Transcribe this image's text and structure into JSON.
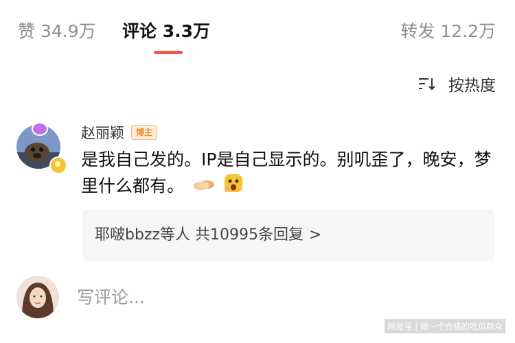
{
  "tabs": {
    "likes": "赞 34.9万",
    "comments": "评论 3.3万",
    "reposts": "转发 12.2万"
  },
  "sort": {
    "label": "按热度",
    "icon": "sort-icon"
  },
  "comment": {
    "user_name": "赵丽颖",
    "badge": "博主",
    "text": "是我自己发的。IP是自己显示的。别叽歪了，晚安，梦里什么都有。",
    "emojis": [
      "handshake-emoji",
      "surprised-face-emoji"
    ],
    "replies_summary": "耶啵bbzz等人 共10995条回复",
    "replies_chevron": ">"
  },
  "composer": {
    "placeholder": "写评论..."
  },
  "watermark": "网易号 | 做一个合格的吃瓜群众",
  "colors": {
    "accent": "#f2554a",
    "badge_orange": "#f08a24",
    "muted_text": "#8e8e8e"
  }
}
